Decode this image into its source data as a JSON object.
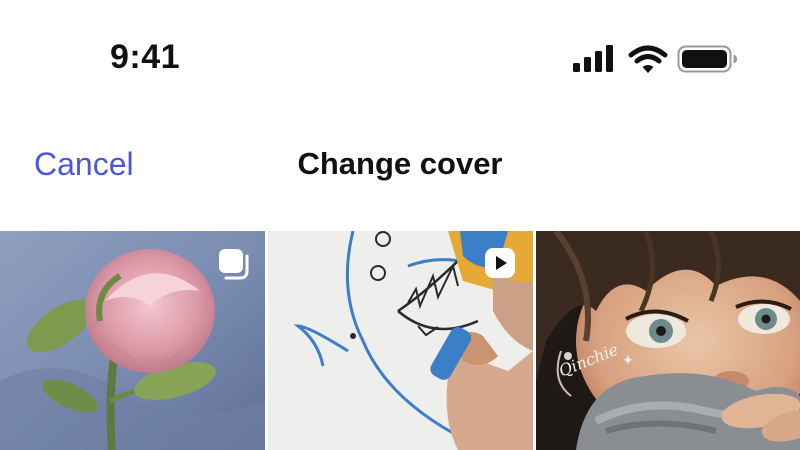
{
  "status_bar": {
    "time": "9:41",
    "icons": [
      "cellular-signal-icon",
      "wifi-icon",
      "battery-icon"
    ]
  },
  "nav": {
    "cancel_label": "Cancel",
    "title": "Change cover"
  },
  "colors": {
    "accent": "#4a58d8",
    "text": "#111111",
    "background": "#ffffff"
  },
  "grid": {
    "items": [
      {
        "subject": "rose painting",
        "badge_icon": "multiple-photos-icon"
      },
      {
        "subject": "shark drawing with marker",
        "badge_icon": "video-play-icon"
      },
      {
        "subject": "illustrated portrait",
        "signature": "Qinchie"
      }
    ]
  }
}
